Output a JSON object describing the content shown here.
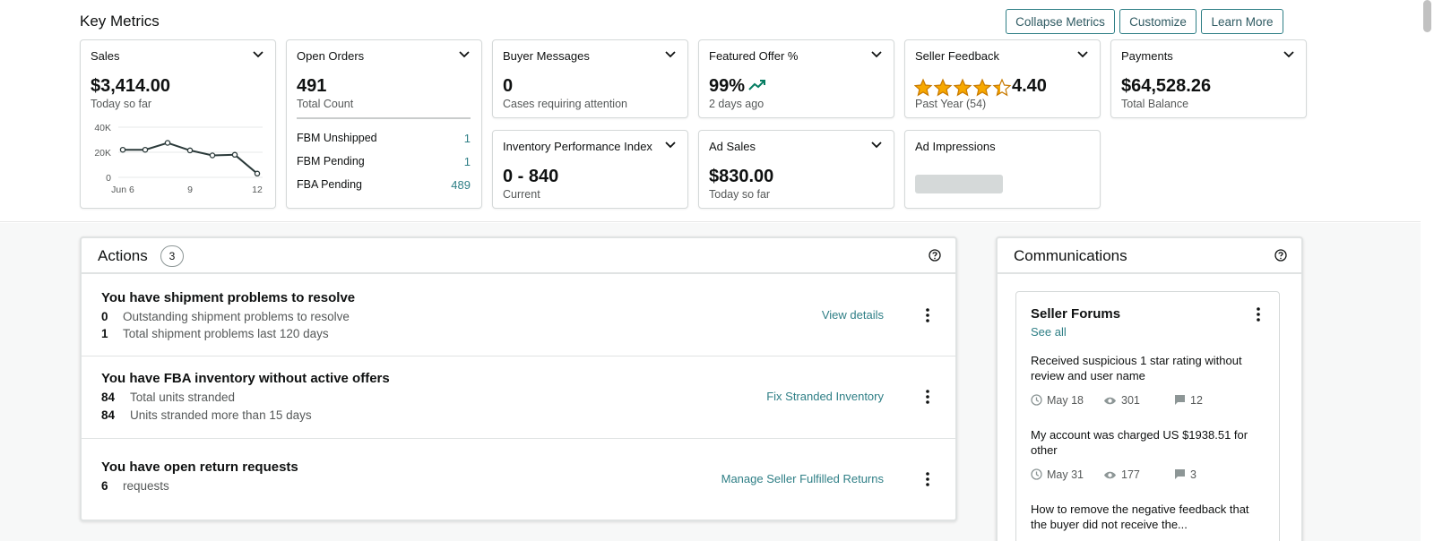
{
  "key_metrics": {
    "title": "Key Metrics",
    "buttons": {
      "collapse": "Collapse Metrics",
      "customize": "Customize",
      "learn_more": "Learn More"
    }
  },
  "cards": {
    "sales": {
      "title": "Sales",
      "value": "$3,414.00",
      "sub": "Today so far"
    },
    "open_orders": {
      "title": "Open Orders",
      "value": "491",
      "sub": "Total Count",
      "rows": [
        {
          "label": "FBM Unshipped",
          "value": "1"
        },
        {
          "label": "FBM Pending",
          "value": "1"
        },
        {
          "label": "FBA Pending",
          "value": "489"
        }
      ]
    },
    "buyer_messages": {
      "title": "Buyer Messages",
      "value": "0",
      "sub": "Cases requiring attention"
    },
    "featured_offer": {
      "title": "Featured Offer %",
      "value": "99%",
      "sub": "2 days ago",
      "trend_color": "#067d62"
    },
    "seller_feedback": {
      "title": "Seller Feedback",
      "value": "4.40",
      "sub": "Past Year (54)",
      "rating": 4.4,
      "star_color": "#f7a800"
    },
    "payments": {
      "title": "Payments",
      "value": "$64,528.26",
      "sub": "Total Balance"
    },
    "inventory": {
      "title": "Inventory Performance Index",
      "value": "0 - 840",
      "sub": "Current"
    },
    "ad_sales": {
      "title": "Ad Sales",
      "value": "$830.00",
      "sub": "Today so far"
    },
    "ad_impressions": {
      "title": "Ad Impressions"
    }
  },
  "chart_data": {
    "type": "line",
    "x": [
      6,
      7,
      8,
      9,
      10,
      11,
      12
    ],
    "values": [
      22000,
      22000,
      27500,
      21500,
      17500,
      18000,
      3000
    ],
    "ylim": [
      0,
      40000
    ],
    "yticks": [
      "40K",
      "20K",
      "0"
    ],
    "xticks": [
      "Jun 6",
      "9",
      "12"
    ],
    "xlabel": "",
    "ylabel": ""
  },
  "actions": {
    "title": "Actions",
    "count": "3",
    "items": [
      {
        "title": "You have shipment problems to resolve",
        "lines": [
          {
            "n": "0",
            "text": "Outstanding shipment problems to resolve"
          },
          {
            "n": "1",
            "text": "Total shipment problems last 120 days"
          }
        ],
        "link": "View details"
      },
      {
        "title": "You have FBA inventory without active offers",
        "lines": [
          {
            "n": "84",
            "text": "Total units stranded"
          },
          {
            "n": "84",
            "text": "Units stranded more than 15 days"
          }
        ],
        "link": "Fix Stranded Inventory"
      },
      {
        "title": "You have open return requests",
        "lines": [
          {
            "n": "6",
            "text": "requests"
          }
        ],
        "link": "Manage Seller Fulfilled Returns"
      }
    ]
  },
  "communications": {
    "title": "Communications",
    "forums": {
      "title": "Seller Forums",
      "see_all": "See all",
      "posts": [
        {
          "text": "Received suspicious 1 star rating without review and user name",
          "date": "May 18",
          "views": "301",
          "replies": "12"
        },
        {
          "text": "My account was charged US $1938.51 for other",
          "date": "May 31",
          "views": "177",
          "replies": "3"
        },
        {
          "text": "How to remove the negative feedback that the buyer did not receive the...",
          "date": "",
          "views": "",
          "replies": ""
        }
      ]
    }
  },
  "colors": {
    "accent": "#2f7f86",
    "text": "#0f1111",
    "muted": "#565959",
    "star": "#f7a800",
    "trend": "#067d62"
  }
}
